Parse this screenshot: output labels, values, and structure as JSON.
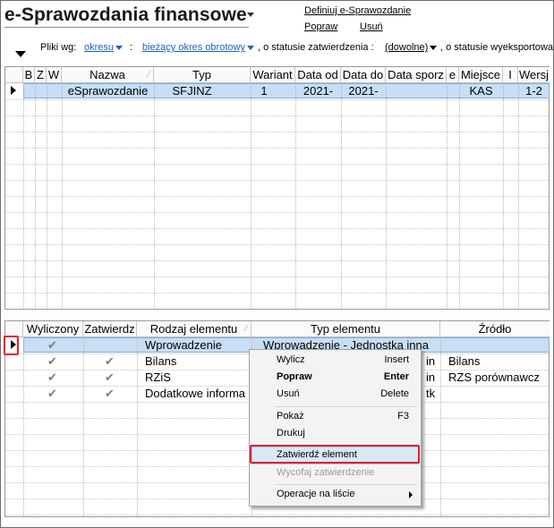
{
  "header": {
    "title": "e-Sprawozdania finansowe",
    "links": {
      "define": "Definiuj e-Sprawozdanie",
      "edit": "Popraw",
      "delete": "Usuń"
    }
  },
  "filter": {
    "files_by_label": "Pliki wg:",
    "period_dropdown": "okresu",
    "colon": ":",
    "period_value": "bieżący okres obrotowy",
    "approval_label": ", o statusie zatwierdzenia :",
    "approval_value": "(dowolne)",
    "export_label": ", o statusie wyeksportowa"
  },
  "top_grid": {
    "columns": [
      "B",
      "Z",
      "W",
      "Nazwa",
      "Typ",
      "Wariant",
      "Data od",
      "Data do",
      "Data sporz",
      "e",
      "Miejsce",
      "I",
      "Wersj"
    ],
    "rows": [
      {
        "b": "",
        "z": "",
        "w": "",
        "nazwa": "eSprawozdanie",
        "typ": "SFJINZ",
        "wariant": "1",
        "data_od": "2021-",
        "data_do": "2021-",
        "data_sporz": "",
        "e": "",
        "miejsce": "KAS",
        "i": "",
        "wersja": "1-2"
      }
    ]
  },
  "bottom_grid": {
    "columns": [
      "Wyliczony",
      "Zatwierdz",
      "Rodzaj elementu",
      "Typ elementu",
      "Źródło"
    ],
    "rows": [
      {
        "wyliczony": "✔",
        "zatwierdz": "",
        "rodzaj": "Wprowadzenie",
        "typ": "Wprowadzenie - Jednostka inna",
        "zrodlo": ""
      },
      {
        "wyliczony": "✔",
        "zatwierdz": "✔",
        "rodzaj": "Bilans",
        "typ": "in",
        "zrodlo": "Bilans"
      },
      {
        "wyliczony": "✔",
        "zatwierdz": "✔",
        "rodzaj": "RZiS",
        "typ": "in",
        "zrodlo": "RZS porównawcz"
      },
      {
        "wyliczony": "✔",
        "zatwierdz": "✔",
        "rodzaj": "Dodatkowe informa",
        "typ": "tk",
        "zrodlo": ""
      }
    ]
  },
  "context_menu": {
    "items": [
      {
        "label": "Wylicz",
        "shortcut": "Insert"
      },
      {
        "label": "Popraw",
        "shortcut": "Enter"
      },
      {
        "label": "Usuń",
        "shortcut": "Delete"
      },
      {
        "label": "Pokaż",
        "shortcut": "F3"
      },
      {
        "label": "Drukuj",
        "shortcut": ""
      },
      {
        "label": "Zatwierdź element",
        "shortcut": ""
      },
      {
        "label": "Wycofaj zatwierdzenie",
        "shortcut": ""
      },
      {
        "label": "Operacje na liście",
        "shortcut": ""
      }
    ]
  },
  "colors": {
    "selection": "#c7def4",
    "highlight_box": "#e0202e",
    "link_blue": "#1f5fbf"
  }
}
